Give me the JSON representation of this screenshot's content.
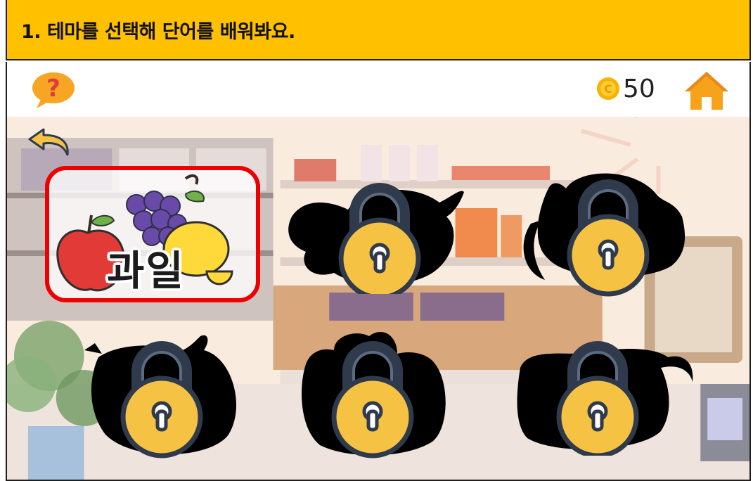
{
  "instruction": {
    "text": "1. 테마를 선택해 단어를 배워봐요."
  },
  "topbar": {
    "coins": "50",
    "help_icon": "question-bubble-icon",
    "coin_icon": "coin-icon",
    "home_icon": "home-icon"
  },
  "navigation": {
    "back_icon": "back-arrow-icon"
  },
  "themes": [
    {
      "label": "과일",
      "state": "unlocked",
      "selected": true
    },
    {
      "label": "",
      "state": "locked"
    },
    {
      "label": "",
      "state": "locked"
    },
    {
      "label": "",
      "state": "locked"
    },
    {
      "label": "",
      "state": "locked"
    },
    {
      "label": "",
      "state": "locked"
    }
  ],
  "colors": {
    "header_bar": "#ffc000",
    "selected_border": "#ee0000",
    "lock_body": "#f6c244",
    "lock_outline": "#2f3b4c",
    "coin": "#f5b400",
    "home": "#f7a21a"
  }
}
